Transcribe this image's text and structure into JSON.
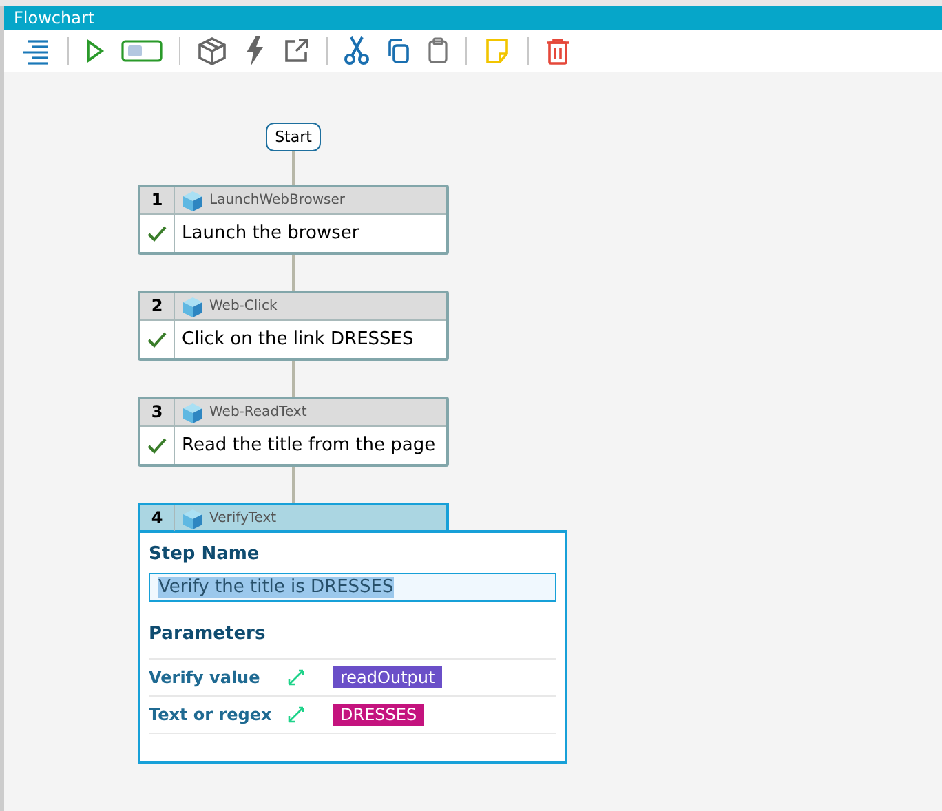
{
  "window": {
    "title": "Flowchart"
  },
  "start": {
    "label": "Start"
  },
  "steps": [
    {
      "number": "1",
      "type": "LaunchWebBrowser",
      "description": "Launch the browser",
      "passed": true,
      "expanded": false
    },
    {
      "number": "2",
      "type": "Web-Click",
      "description": "Click on the link DRESSES",
      "passed": true,
      "expanded": false
    },
    {
      "number": "3",
      "type": "Web-ReadText",
      "description": "Read the title from the page",
      "passed": true,
      "expanded": false
    },
    {
      "number": "4",
      "type": "VerifyText",
      "expanded": true,
      "editor": {
        "step_name_label": "Step Name",
        "step_name_value": "Verify the title is DRESSES",
        "parameters_label": "Parameters",
        "parameters": [
          {
            "name": "Verify value",
            "value": "readOutput",
            "color": "#6a4fc8"
          },
          {
            "name": "Text or regex",
            "value": "DRESSES",
            "color": "#c4137e"
          }
        ]
      }
    }
  ]
}
